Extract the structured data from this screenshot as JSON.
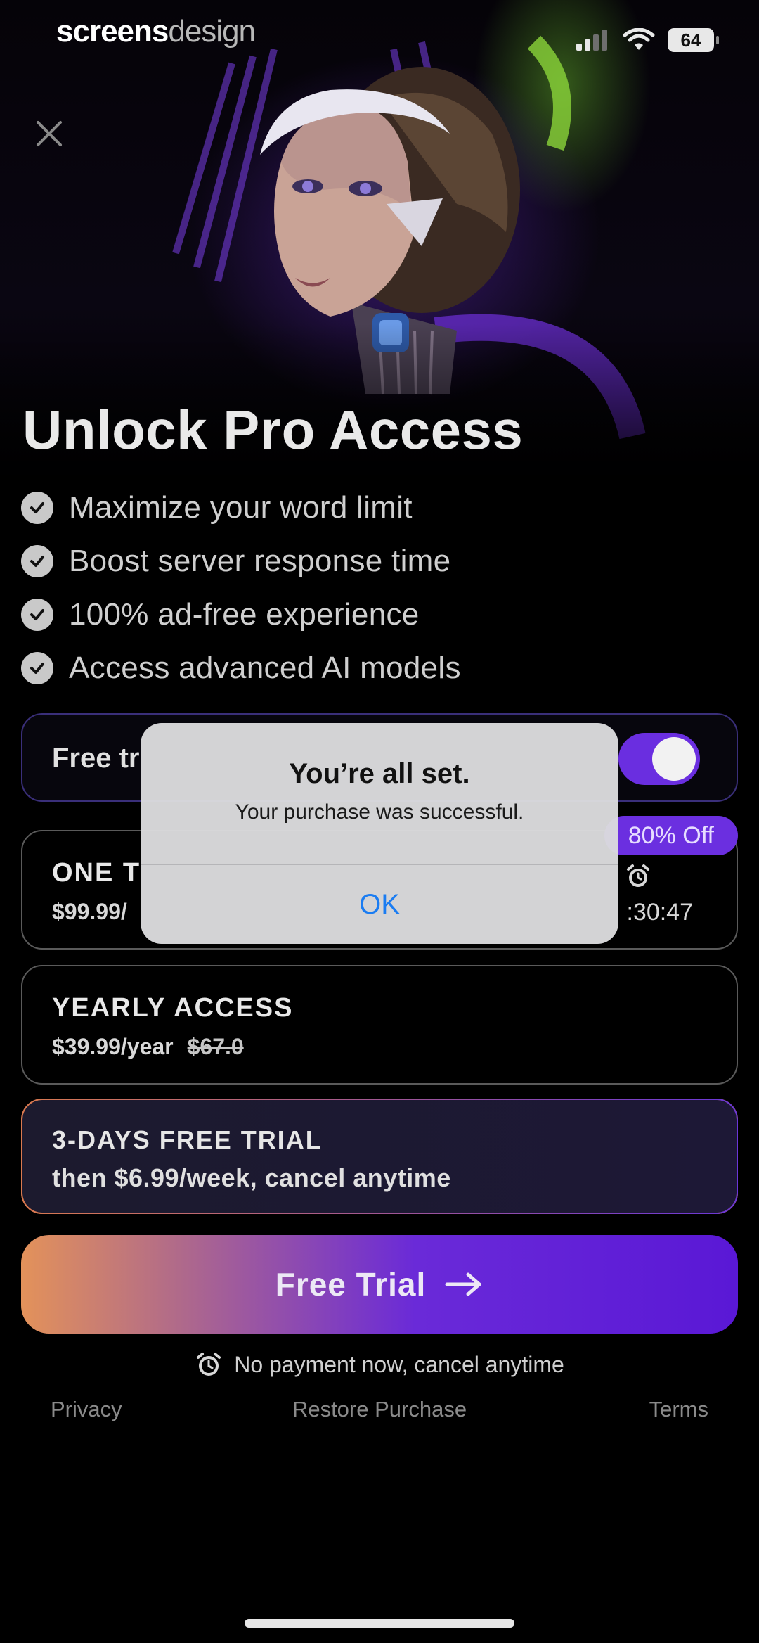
{
  "status_bar": {
    "brand_bold": "screens",
    "brand_light": "design",
    "battery": "64",
    "icons": [
      "cellular-signal-icon",
      "wifi-icon",
      "battery-icon"
    ]
  },
  "close": {
    "icon": "close-icon"
  },
  "paywall": {
    "title": "Unlock Pro Access",
    "features": [
      "Maximize your word limit",
      "Boost server response time",
      "100% ad-free experience",
      "Access advanced AI models"
    ],
    "free_trial_toggle": {
      "label": "Free tr",
      "state": "on"
    },
    "plans": {
      "one_time": {
        "name": "ONE T",
        "price": "$99.99/",
        "badge": "80% Off",
        "timer": ":30:47"
      },
      "yearly": {
        "name": "YEARLY ACCESS",
        "price": "$39.99/year",
        "old_price": "$67.0"
      },
      "trial": {
        "name": "3-DAYS FREE TRIAL",
        "subtitle": "then $6.99/week, cancel anytime",
        "selected": true
      }
    },
    "cta_label": "Free Trial",
    "note": "No payment now, cancel anytime",
    "footer": {
      "privacy": "Privacy",
      "restore": "Restore Purchase",
      "terms": "Terms"
    }
  },
  "alert": {
    "title": "You’re all set.",
    "message": "Your purchase was successful.",
    "ok_label": "OK"
  },
  "colors": {
    "accent_purple": "#6b2fe0",
    "cta_gradient_start": "#e3925a",
    "cta_gradient_end": "#5a18d6",
    "alert_button": "#1a7cf2"
  }
}
